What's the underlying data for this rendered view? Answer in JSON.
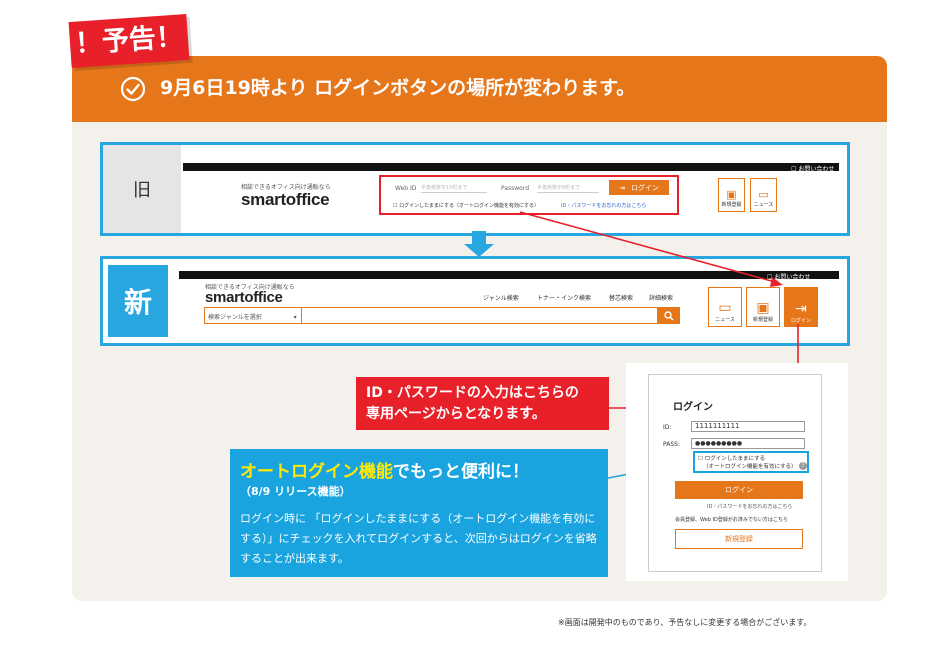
{
  "notice_badge": "！予告！",
  "header": {
    "text": "9月6日19時より ログインボタンの場所が変わります。",
    "icon": "check-circle-icon",
    "color": "#e6761a"
  },
  "old": {
    "label": "旧",
    "contact": "お問い合わせ",
    "tagline": "相談できるオフィス向け通販なら",
    "logo": "smartoffice",
    "webid_label": "Web ID",
    "webid_placeholder": "半角英数字10桁まで",
    "password_label": "Password",
    "password_placeholder": "半角英数字8桁まで",
    "login_button": "ログイン",
    "keep_login": "ログインしたままにする（オートログイン機能を有効にする）",
    "forgot_link": "ID・パスワードをお忘れの方はこちら",
    "register": "新規登録",
    "news": "ニュース"
  },
  "new": {
    "label": "新",
    "contact": "お問い合わせ",
    "tagline": "相談できるオフィス向け通販なら",
    "logo": "smartoffice",
    "nav": [
      "ジャンル検索",
      "トナー・インク検索",
      "替芯検索",
      "詳細検索"
    ],
    "genre_select": "検索ジャンルを選択",
    "news": "ニュース",
    "register": "新規登録",
    "login": "ログイン"
  },
  "callout_red": {
    "line1": "ID・パスワードの入力はこちらの",
    "line2": "専用ページからとなります。"
  },
  "callout_blue": {
    "title_highlight": "オートログイン機能",
    "title_rest": "でもっと便利に！",
    "subtitle": "（8/9 リリース機能）",
    "body": "ログイン時に 「ログインしたままにする（オートログイン機能を有効にする）」にチェックを入れてログインすると、次回からはログインを省略することが出来ます。"
  },
  "login_form": {
    "title": "ログイン",
    "id_label": "ID:",
    "id_value": "1111111111",
    "pass_label": "PASS:",
    "pass_value": "●●●●●●●●●",
    "keep_line1": "ログインしたままにする",
    "keep_line2": "（オートログイン機能を有効にする）",
    "login_button": "ログイン",
    "forgot": "ID・パスワードをお忘れの方はこちら",
    "member_note": "会員登録、Web ID登録がお済みでない方はこちら",
    "register_button": "新規登録"
  },
  "footnote": "※画面は開発中のものであり、予告なしに変更する場合がございます。"
}
